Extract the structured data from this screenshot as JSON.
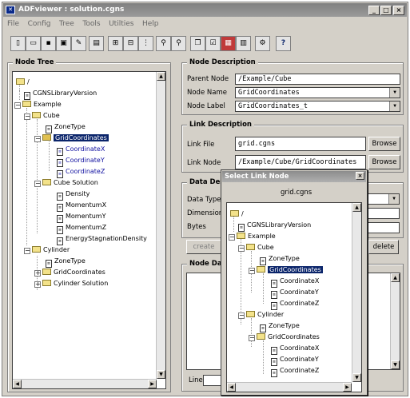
{
  "window": {
    "title": "ADFviewer : solution.cgns",
    "app_icon": "adf-icon"
  },
  "menu": [
    "File",
    "Config",
    "Tree",
    "Tools",
    "Utilties",
    "Help"
  ],
  "toolbar": {
    "icons": [
      "new-file-icon",
      "open-folder-icon",
      "save-icon",
      "save-as-icon",
      "edit-icon",
      "view-icon",
      "expand-tree-icon",
      "collapse-tree-icon",
      "link-icon",
      "find-icon",
      "find-next-icon",
      "copy-icon",
      "check-icon",
      "plot-icon",
      "table-icon",
      "settings-icon",
      "help-icon"
    ],
    "help_label": "?"
  },
  "node_tree": {
    "title": "Node Tree",
    "items": [
      {
        "label": "/",
        "type": "folder"
      },
      {
        "label": "CGNSLibraryVersion",
        "type": "doc"
      },
      {
        "label": "Example",
        "type": "folder"
      },
      {
        "label": "Cube",
        "type": "folder"
      },
      {
        "label": "ZoneType",
        "type": "doc"
      },
      {
        "label": "GridCoordinates",
        "type": "folder",
        "selected": true
      },
      {
        "label": "CoordinateX",
        "type": "doc",
        "linked": true
      },
      {
        "label": "CoordinateY",
        "type": "doc",
        "linked": true
      },
      {
        "label": "CoordinateZ",
        "type": "doc",
        "linked": true
      },
      {
        "label": "Cube Solution",
        "type": "folder"
      },
      {
        "label": "Density",
        "type": "doc"
      },
      {
        "label": "MomentumX",
        "type": "doc"
      },
      {
        "label": "MomentumY",
        "type": "doc"
      },
      {
        "label": "MomentumZ",
        "type": "doc"
      },
      {
        "label": "EnergyStagnationDensity",
        "type": "doc"
      },
      {
        "label": "Cylinder",
        "type": "folder"
      },
      {
        "label": "ZoneType",
        "type": "doc"
      },
      {
        "label": "GridCoordinates",
        "type": "folder"
      },
      {
        "label": "Cylinder Solution",
        "type": "folder"
      }
    ]
  },
  "node_description": {
    "title": "Node Description",
    "parent_node_label": "Parent Node",
    "parent_node": "/Example/Cube",
    "node_name_label": "Node Name",
    "node_name": "GridCoordinates",
    "node_label_label": "Node Label",
    "node_label": "GridCoordinates_t"
  },
  "link_description": {
    "title": "Link Description",
    "link_file_label": "Link File",
    "link_file": "grid.cgns",
    "link_node_label": "Link Node",
    "link_node": "/Example/Cube/GridCoordinates",
    "browse_label": "Browse"
  },
  "data_description": {
    "title": "Data Des",
    "data_type_label": "Data Type",
    "dimension_label": "Dimension",
    "bytes_label": "Bytes",
    "create_label": "create",
    "delete_label": "delete"
  },
  "node_data": {
    "title": "Node Dat",
    "line_label": "Line"
  },
  "dialog": {
    "title": "Select Link Node",
    "file": "grid.cgns",
    "items": [
      {
        "label": "/",
        "type": "folder"
      },
      {
        "label": "CGNSLibraryVersion",
        "type": "doc"
      },
      {
        "label": "Example",
        "type": "folder"
      },
      {
        "label": "Cube",
        "type": "folder"
      },
      {
        "label": "ZoneType",
        "type": "doc"
      },
      {
        "label": "GridCoordinates",
        "type": "folder",
        "selected": true
      },
      {
        "label": "CoordinateX",
        "type": "doc"
      },
      {
        "label": "CoordinateY",
        "type": "doc"
      },
      {
        "label": "CoordinateZ",
        "type": "doc"
      },
      {
        "label": "Cylinder",
        "type": "folder"
      },
      {
        "label": "ZoneType",
        "type": "doc"
      },
      {
        "label": "GridCoordinates",
        "type": "folder"
      },
      {
        "label": "CoordinateX",
        "type": "doc"
      },
      {
        "label": "CoordinateY",
        "type": "doc"
      },
      {
        "label": "CoordinateZ",
        "type": "doc"
      }
    ]
  },
  "colors": {
    "selection": "#0a246a",
    "link_text": "#1010a0",
    "folder": "#f3e28a",
    "titlebar": "#808080"
  }
}
